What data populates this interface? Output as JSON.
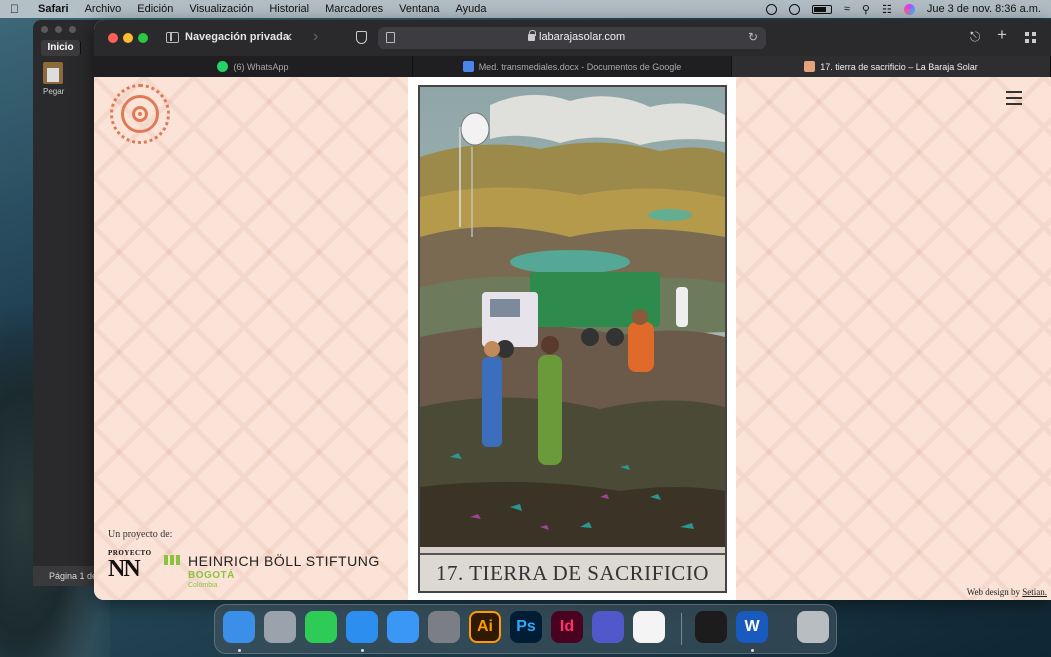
{
  "menubar": {
    "app": "Safari",
    "items": [
      "Archivo",
      "Edición",
      "Visualización",
      "Historial",
      "Marcadores",
      "Ventana",
      "Ayuda"
    ],
    "datetime": "Jue 3 de nov.  8:36 a.m."
  },
  "word_window": {
    "tab_label": "Inicio",
    "paste_label": "Pegar",
    "page_label": "Página 1 de"
  },
  "safari": {
    "private_label": "Navegación privada",
    "url": "labarajasolar.com",
    "tabs": [
      {
        "label": "(6) WhatsApp",
        "favicon": "whatsapp-icon"
      },
      {
        "label": "Med. transmediales.docx - Documentos de Google",
        "favicon": "google-docs-icon"
      },
      {
        "label": "17. tierra de sacrificio – La Baraja Solar",
        "favicon": "baraja-solar-icon"
      }
    ]
  },
  "page": {
    "card_title": "17. TIERRA DE SACRIFICIO",
    "project_label": "Un proyecto de:",
    "nn_top": "PROYECTO",
    "nn_big": "NN",
    "boll_name": "HEINRICH BÖLL STIFTUNG",
    "boll_city": "BOGOTÁ",
    "boll_country": "Colombia",
    "credits_prefix": "Web design by ",
    "credits_link": "Setian."
  },
  "colors": {
    "page_bg": "#fbe3d8",
    "logo_orange": "#e07a55",
    "boll_green": "#8ac43f",
    "truck_green": "#2f8a4e"
  },
  "dock": {
    "apps": [
      {
        "name": "finder-icon",
        "label": "",
        "color": "#3b8fe8"
      },
      {
        "name": "launchpad-icon",
        "label": "",
        "color": "#9aa3ab"
      },
      {
        "name": "facetime-icon",
        "label": "",
        "color": "#2ecc57"
      },
      {
        "name": "safari-icon",
        "label": "",
        "color": "#2c8ff0"
      },
      {
        "name": "mail-icon",
        "label": "",
        "color": "#3a97f5"
      },
      {
        "name": "system-settings-icon",
        "label": "",
        "color": "#7b7f85"
      },
      {
        "name": "illustrator-icon",
        "label": "Ai",
        "color": "#2e1a00"
      },
      {
        "name": "photoshop-icon",
        "label": "Ps",
        "color": "#001d34"
      },
      {
        "name": "indesign-icon",
        "label": "Id",
        "color": "#49021f"
      },
      {
        "name": "teams-icon",
        "label": "",
        "color": "#5059c9"
      },
      {
        "name": "chrome-icon",
        "label": "",
        "color": "#f4f4f4"
      },
      {
        "name": "terminal-icon",
        "label": "",
        "color": "#1c1c1c"
      },
      {
        "name": "word-icon",
        "label": "W",
        "color": "#185abd"
      },
      {
        "name": "trash-icon",
        "label": "",
        "color": "#b8bdc2"
      }
    ]
  }
}
